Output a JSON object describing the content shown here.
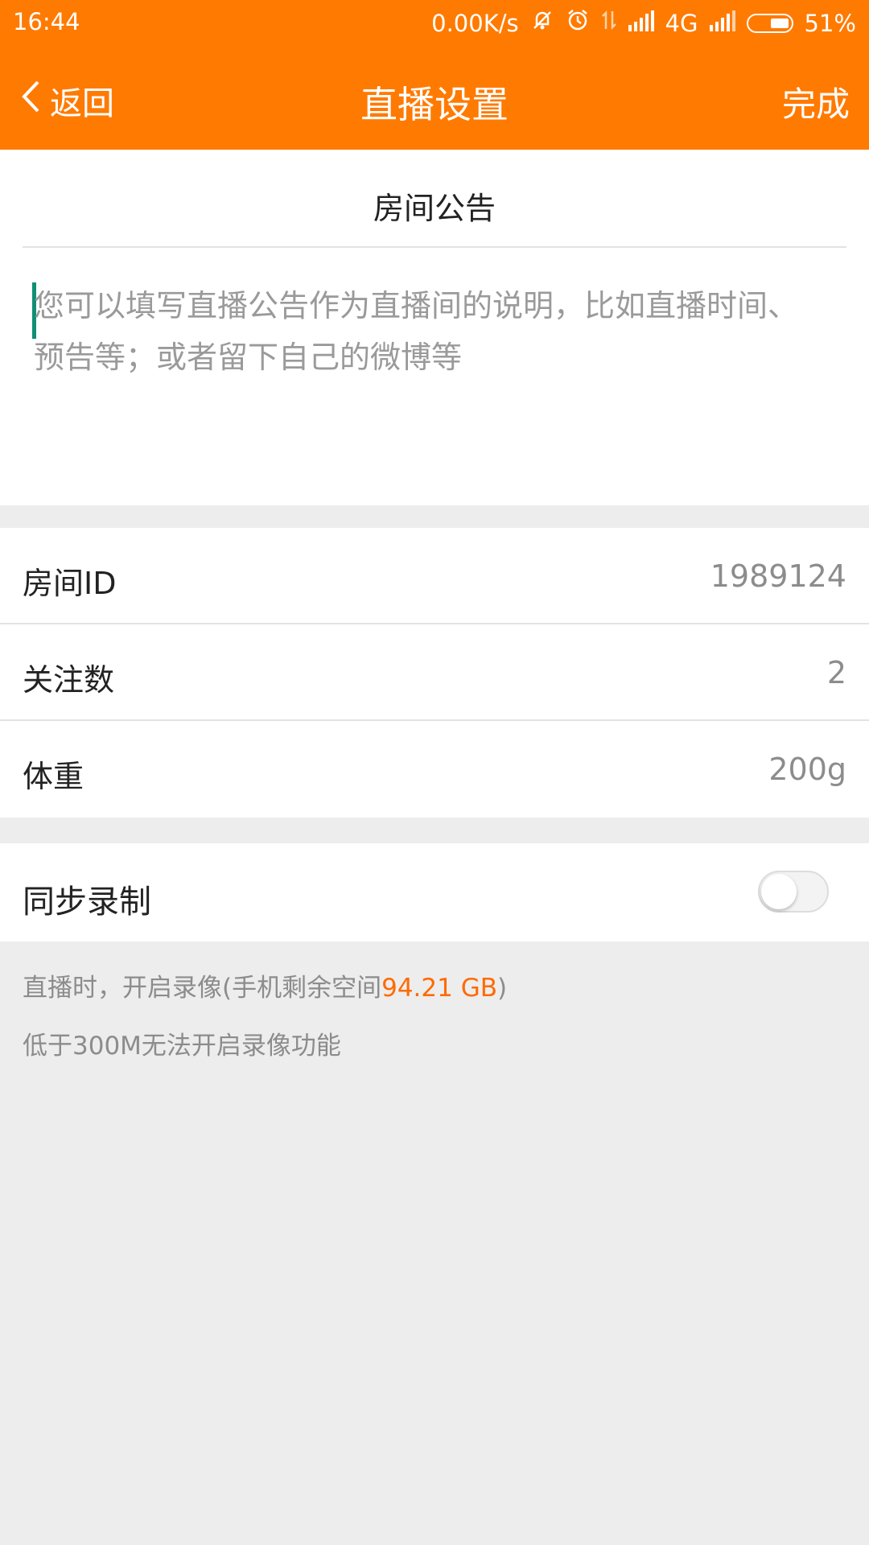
{
  "status_bar": {
    "time": "16:44",
    "net_speed": "0.00K/s",
    "network": "4G",
    "battery": "51%"
  },
  "nav": {
    "back_label": "返回",
    "title": "直播设置",
    "done_label": "完成"
  },
  "announcement": {
    "title": "房间公告",
    "placeholder_line1": "您可以填写直播公告作为直播间的说明，比如直播时间、",
    "placeholder_line2": "预告等；或者留下自己的微博等"
  },
  "info_rows": [
    {
      "label": "房间ID",
      "value": "1989124"
    },
    {
      "label": "关注数",
      "value": "2"
    },
    {
      "label": "体重",
      "value": "200g"
    }
  ],
  "record": {
    "label": "同步录制",
    "enabled": false,
    "note_prefix": "直播时，开启录像(手机剩余空间",
    "free_space": "94.21 GB",
    "note_suffix": ")",
    "note_line2": "低于300M无法开启录像功能"
  },
  "colors": {
    "accent": "#ff7a00",
    "highlight": "#ff6a00",
    "cursor": "#0f8f74"
  }
}
